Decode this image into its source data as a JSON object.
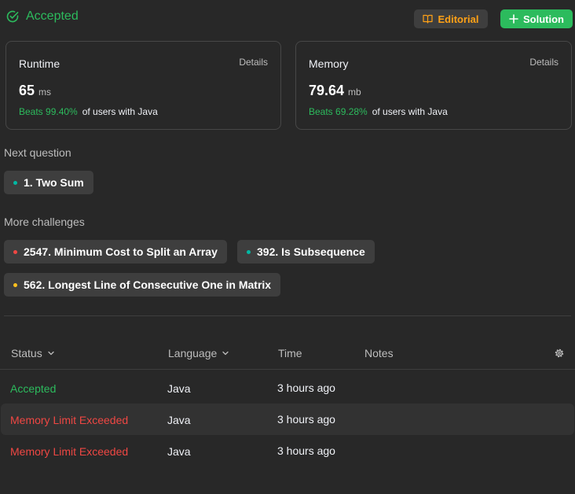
{
  "header": {
    "status": "Accepted",
    "editorial_label": "Editorial",
    "solution_label": "Solution"
  },
  "runtime": {
    "title": "Runtime",
    "details": "Details",
    "value": "65",
    "unit": "ms",
    "beats": "Beats 99.40%",
    "suffix": "of users with Java"
  },
  "memory": {
    "title": "Memory",
    "details": "Details",
    "value": "79.64",
    "unit": "mb",
    "beats": "Beats 69.28%",
    "suffix": "of users with Java"
  },
  "next_question": {
    "label": "Next question",
    "item": {
      "title": "1. Two Sum",
      "difficulty_color": "#00b8a3"
    }
  },
  "more_challenges": {
    "label": "More challenges",
    "items": [
      {
        "title": "2547. Minimum Cost to Split an Array",
        "difficulty_color": "#ef4743"
      },
      {
        "title": "392. Is Subsequence",
        "difficulty_color": "#00b8a3"
      },
      {
        "title": "562. Longest Line of Consecutive One in Matrix",
        "difficulty_color": "#ffc01e"
      }
    ]
  },
  "table": {
    "headers": [
      "Status",
      "Language",
      "Time",
      "Notes"
    ],
    "rows": [
      {
        "status": "Accepted",
        "language": "Java",
        "time": "3 hours ago"
      },
      {
        "status": "Memory Limit Exceeded",
        "language": "Java",
        "time": "3 hours ago"
      },
      {
        "status": "Memory Limit Exceeded",
        "language": "Java",
        "time": "3 hours ago"
      }
    ]
  },
  "colors": {
    "accent_green": "#2cbb5d",
    "accent_orange": "#ffa116",
    "error_red": "#ef4743",
    "background": "#282828"
  },
  "icons": [
    "check-circle-icon",
    "book-icon",
    "plus-icon",
    "chevron-down-icon",
    "gear-icon"
  ]
}
